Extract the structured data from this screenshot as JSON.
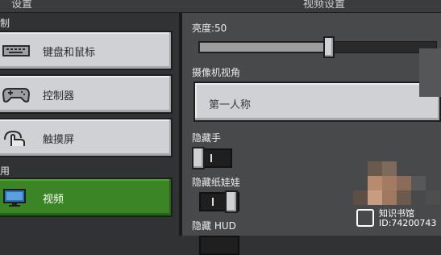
{
  "header": {
    "left_title": "设置",
    "right_title": "视频设置"
  },
  "sidebar": {
    "section_controls": "制",
    "section_general": "用",
    "items": [
      {
        "label": "键盘和鼠标",
        "icon": "keyboard-icon"
      },
      {
        "label": "控制器",
        "icon": "controller-icon"
      },
      {
        "label": "触摸屏",
        "icon": "touch-icon"
      },
      {
        "label": "视频",
        "icon": "monitor-icon",
        "active": true
      }
    ]
  },
  "video": {
    "brightness_label": "亮度:50",
    "brightness_value": 0.5,
    "camera_label": "摄像机视角",
    "camera_value": "第一人称",
    "hide_hand_label": "隐藏手",
    "hide_hand_on": false,
    "hide_paperdoll_label": "隐藏纸娃娃",
    "hide_paperdoll_on": true,
    "hide_hud_label": "隐藏 HUD"
  },
  "watermark": {
    "line1": "知识书馆",
    "line2": "ID:74200743"
  },
  "colors": {
    "accent_green": "#3c8527",
    "panel": "#48494a",
    "button": "#d0d1d4"
  }
}
